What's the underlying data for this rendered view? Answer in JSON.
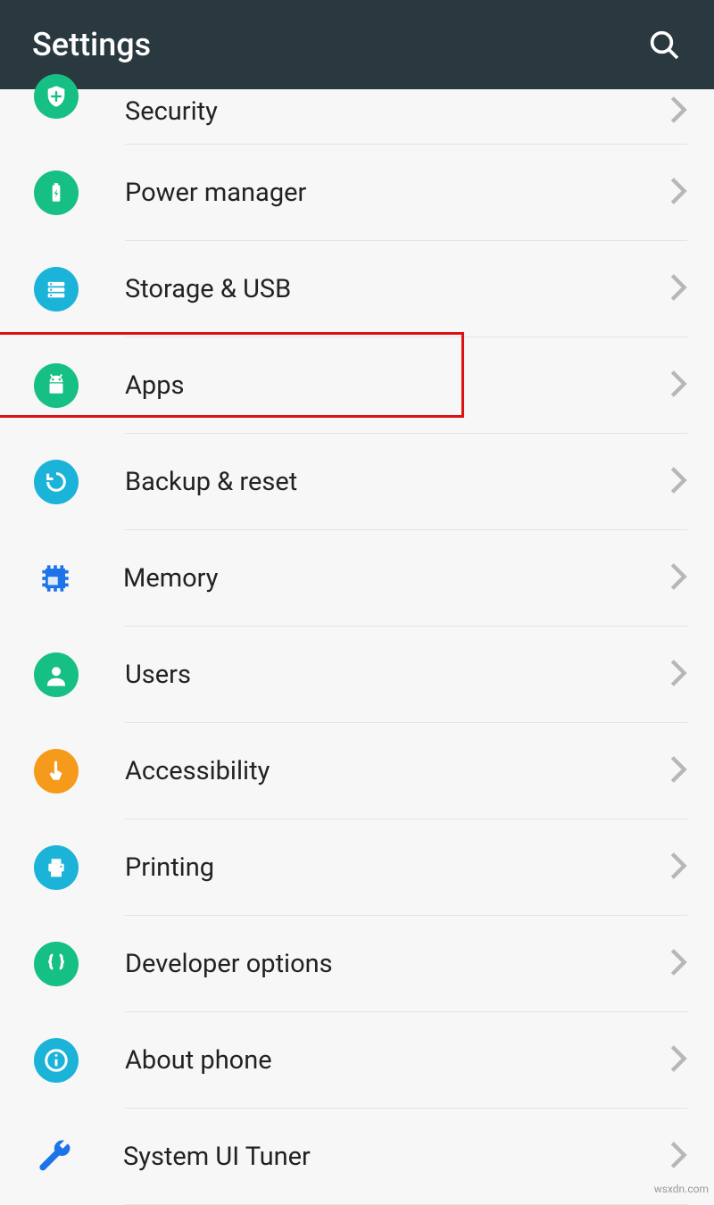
{
  "header": {
    "title": "Settings"
  },
  "items": [
    {
      "label": "Security",
      "icon": "shield",
      "color": "#16bf83",
      "highlighted": false
    },
    {
      "label": "Power manager",
      "icon": "battery",
      "color": "#16bf83",
      "highlighted": false
    },
    {
      "label": "Storage & USB",
      "icon": "storage",
      "color": "#1cb3d9",
      "highlighted": false
    },
    {
      "label": "Apps",
      "icon": "android",
      "color": "#16bf83",
      "highlighted": true
    },
    {
      "label": "Backup & reset",
      "icon": "refresh",
      "color": "#1cb3d9",
      "highlighted": false
    },
    {
      "label": "Memory",
      "icon": "chip",
      "color": "#1d74e8",
      "highlighted": false
    },
    {
      "label": "Users",
      "icon": "user",
      "color": "#16bf83",
      "highlighted": false
    },
    {
      "label": "Accessibility",
      "icon": "hand",
      "color": "#f59a1b",
      "highlighted": false
    },
    {
      "label": "Printing",
      "icon": "printer",
      "color": "#1cb3d9",
      "highlighted": false
    },
    {
      "label": "Developer options",
      "icon": "braces",
      "color": "#16bf83",
      "highlighted": false
    },
    {
      "label": "About phone",
      "icon": "info",
      "color": "#1cb3d9",
      "highlighted": false
    },
    {
      "label": "System UI Tuner",
      "icon": "wrench",
      "color": "#1d74e8",
      "highlighted": false
    }
  ],
  "watermark": "wsxdn.com"
}
